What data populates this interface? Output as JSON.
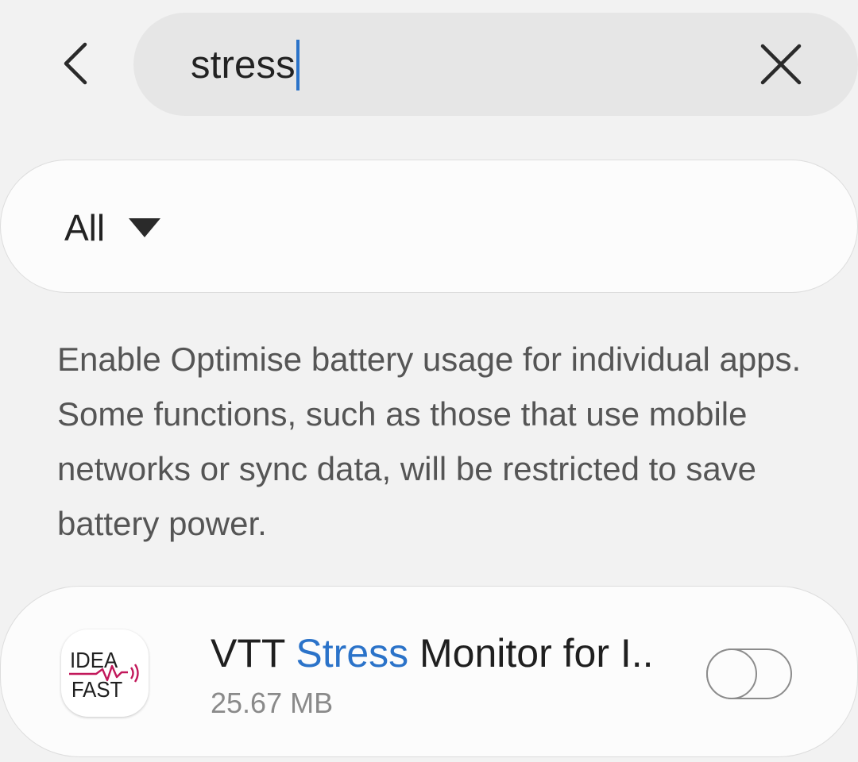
{
  "search": {
    "value": "stress",
    "back_icon": "chevron-left-icon",
    "clear_icon": "close-icon"
  },
  "filter": {
    "selected": "All",
    "arrow_icon": "caret-down-icon"
  },
  "description": "Enable Optimise battery usage for individual apps. Some functions, such as those that use mobile networks or sync data, will be restricted to save battery power.",
  "apps": [
    {
      "name_prefix": "VTT ",
      "name_highlight": "Stress",
      "name_suffix": " Monitor for I..",
      "size": "25.67 MB",
      "icon_text_line1": "IDEA",
      "icon_text_line2": "FAST",
      "optimise_enabled": false
    }
  ],
  "colors": {
    "background": "#f2f2f2",
    "search_pill": "#e6e6e6",
    "card": "#fcfcfc",
    "accent": "#2b73c9",
    "logo_magenta": "#c2185b",
    "secondary_text": "#8a8a8a"
  }
}
